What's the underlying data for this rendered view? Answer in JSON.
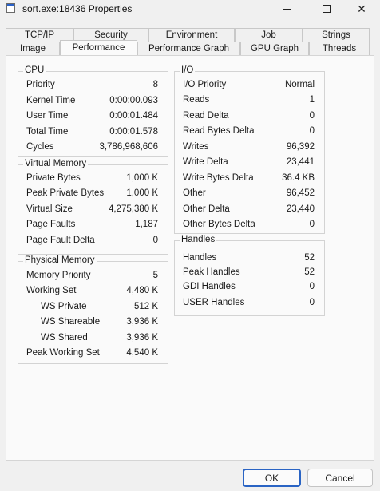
{
  "window": {
    "title": "sort.exe:18436 Properties",
    "controls": {
      "minimize": "minimize",
      "maximize": "maximize",
      "close": "✕"
    }
  },
  "tabs_back": [
    "TCP/IP",
    "Security",
    "Environment",
    "Job",
    "Strings"
  ],
  "tabs_front": [
    "Image",
    "Performance",
    "Performance Graph",
    "GPU Graph",
    "Threads"
  ],
  "active_tab": "Performance",
  "cpu": {
    "title": "CPU",
    "rows": [
      {
        "label": "Priority",
        "value": "8"
      },
      {
        "label": "Kernel Time",
        "value": "0:00:00.093"
      },
      {
        "label": "User Time",
        "value": "0:00:01.484"
      },
      {
        "label": "Total Time",
        "value": "0:00:01.578"
      },
      {
        "label": "Cycles",
        "value": "3,786,968,606"
      }
    ]
  },
  "virtual_memory": {
    "title": "Virtual Memory",
    "rows": [
      {
        "label": "Private Bytes",
        "value": "1,000 K"
      },
      {
        "label": "Peak Private Bytes",
        "value": "1,000 K"
      },
      {
        "label": "Virtual Size",
        "value": "4,275,380 K"
      },
      {
        "label": "Page Faults",
        "value": "1,187"
      },
      {
        "label": "Page Fault Delta",
        "value": "0"
      }
    ]
  },
  "physical_memory": {
    "title": "Physical Memory",
    "rows": [
      {
        "label": "Memory Priority",
        "value": "5"
      },
      {
        "label": "Working Set",
        "value": "4,480 K"
      },
      {
        "label": "WS Private",
        "value": "512 K"
      },
      {
        "label": "WS Shareable",
        "value": "3,936 K"
      },
      {
        "label": "WS Shared",
        "value": "3,936 K"
      },
      {
        "label": "Peak Working Set",
        "value": "4,540 K"
      }
    ]
  },
  "io": {
    "title": "I/O",
    "rows": [
      {
        "label": "I/O Priority",
        "value": "Normal"
      },
      {
        "label": "Reads",
        "value": "1"
      },
      {
        "label": "Read Delta",
        "value": "0"
      },
      {
        "label": "Read Bytes Delta",
        "value": "0"
      },
      {
        "label": "Writes",
        "value": "96,392"
      },
      {
        "label": "Write Delta",
        "value": "23,441"
      },
      {
        "label": "Write Bytes Delta",
        "value": "36.4  KB"
      },
      {
        "label": "Other",
        "value": "96,452"
      },
      {
        "label": "Other Delta",
        "value": "23,440"
      },
      {
        "label": "Other Bytes Delta",
        "value": "0"
      }
    ]
  },
  "handles": {
    "title": "Handles",
    "rows": [
      {
        "label": "Handles",
        "value": "52"
      },
      {
        "label": "Peak Handles",
        "value": "52"
      },
      {
        "label": "GDI Handles",
        "value": "0"
      },
      {
        "label": "USER Handles",
        "value": "0"
      }
    ]
  },
  "buttons": {
    "ok": "OK",
    "cancel": "Cancel"
  }
}
